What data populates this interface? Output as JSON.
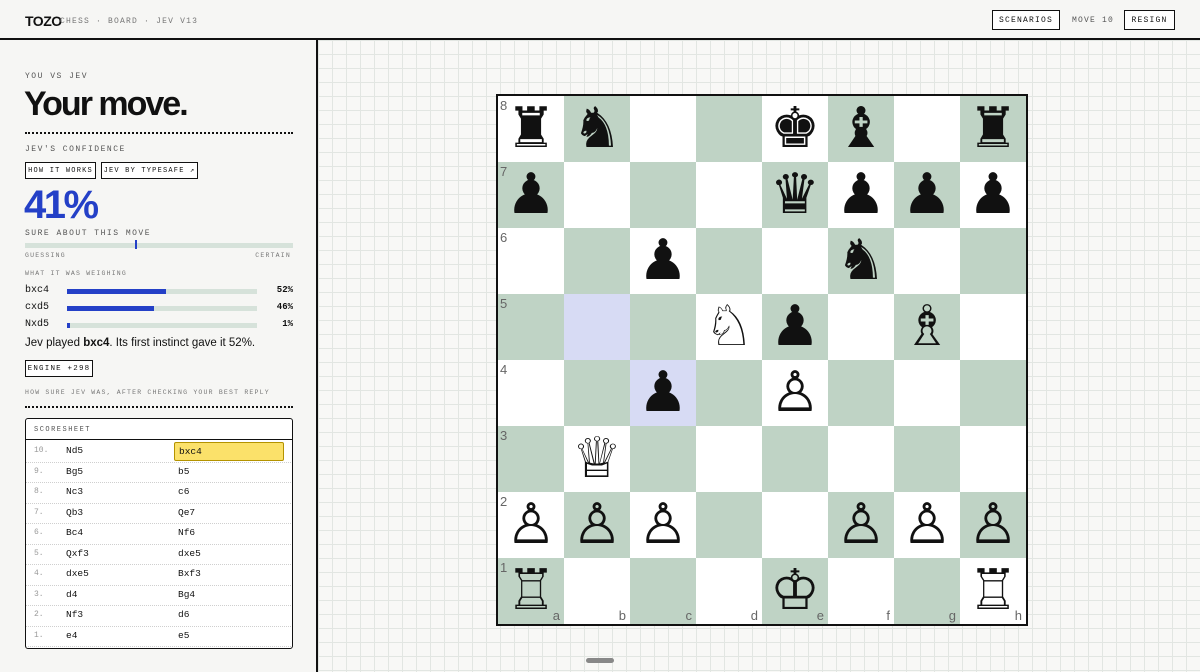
{
  "topbar": {
    "brand": "TOZO",
    "crumbs": [
      "CHESS",
      "BOARD",
      "JEV V13"
    ],
    "scenarios_label": "SCENARIOS",
    "move_label": "MOVE 10",
    "resign_label": "RESIGN"
  },
  "panel": {
    "eyebrow": "YOU VS JEV",
    "headline": "Your move.",
    "confidence_title": "JEV'S CONFIDENCE",
    "how_it_works": "HOW IT WORKS",
    "by_typesafe": "JEV BY TYPESAFE ↗",
    "confidence_pct": "41%",
    "confidence_value": 0.41,
    "sure_label": "SURE ABOUT THIS MOVE",
    "guessing_label": "GUESSING",
    "certain_label": "CERTAIN",
    "weighing_title": "WHAT IT WAS WEIGHING",
    "weighing": [
      {
        "move": "bxc4",
        "pct": "52%",
        "value": 0.52
      },
      {
        "move": "cxd5",
        "pct": "46%",
        "value": 0.46
      },
      {
        "move": "Nxd5",
        "pct": "1%",
        "value": 0.01
      }
    ],
    "played_prefix": "Jev played ",
    "played_move": "bxc4",
    "played_suffix": ". Its first instinct gave it 52%.",
    "engine_label": "ENGINE +298",
    "after_label": "HOW SURE JEV WAS, AFTER CHECKING YOUR BEST REPLY"
  },
  "scoresheet": {
    "title": "SCORESHEET",
    "rows": [
      {
        "num": "10.",
        "white": "Nd5",
        "black": "bxc4"
      },
      {
        "num": "9.",
        "white": "Bg5",
        "black": "b5"
      },
      {
        "num": "8.",
        "white": "Nc3",
        "black": "c6"
      },
      {
        "num": "7.",
        "white": "Qb3",
        "black": "Qe7"
      },
      {
        "num": "6.",
        "white": "Bc4",
        "black": "Nf6"
      },
      {
        "num": "5.",
        "white": "Qxf3",
        "black": "dxe5"
      },
      {
        "num": "4.",
        "white": "dxe5",
        "black": "Bxf3"
      },
      {
        "num": "3.",
        "white": "d4",
        "black": "Bg4"
      },
      {
        "num": "2.",
        "white": "Nf3",
        "black": "d6"
      },
      {
        "num": "1.",
        "white": "e4",
        "black": "e5"
      }
    ]
  },
  "board": {
    "files": [
      "a",
      "b",
      "c",
      "d",
      "e",
      "f",
      "g",
      "h"
    ],
    "ranks": [
      "8",
      "7",
      "6",
      "5",
      "4",
      "3",
      "2",
      "1"
    ],
    "position": [
      [
        "♜",
        "♞",
        "",
        "",
        "♚",
        "♝",
        "",
        "♜"
      ],
      [
        "♟",
        "",
        "",
        "",
        "♛",
        "♟",
        "♟",
        "♟"
      ],
      [
        "",
        "",
        "♟",
        "",
        "",
        "♞",
        "",
        ""
      ],
      [
        "",
        "",
        "",
        "♘",
        "♟",
        "",
        "♗",
        ""
      ],
      [
        "",
        "",
        "♟",
        "",
        "♙",
        "",
        "",
        ""
      ],
      [
        "",
        "♕",
        "",
        "",
        "",
        "",
        "",
        ""
      ],
      [
        "♙",
        "♙",
        "♙",
        "",
        "",
        "♙",
        "♙",
        "♙"
      ],
      [
        "♖",
        "",
        "",
        "",
        "♔",
        "",
        "",
        "♖"
      ]
    ],
    "highlighted": [
      "b5",
      "c4"
    ]
  }
}
